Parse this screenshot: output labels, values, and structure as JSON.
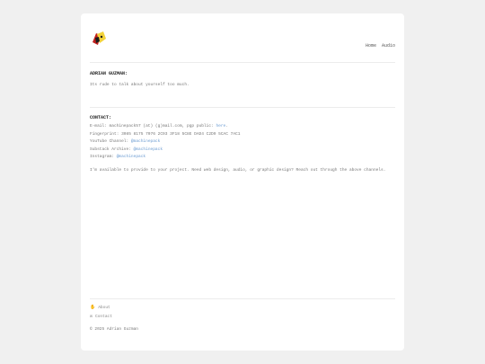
{
  "nav": {
    "home": "Home",
    "audio": "Audio"
  },
  "about": {
    "heading": "ADRIAN GUZMAN:",
    "text": "Its rude to talk about yourself too much."
  },
  "contact": {
    "heading": "CONTACT:",
    "email_label": "E-mail: machinepack57 (at) (g)mail.com, pgp public:",
    "email_link": "here",
    "fingerprint": "Fingerprint: 3085 8175 7076 2C93 3F18 5C8E DAD4 C2D9 5CAC 7AC1",
    "youtube_label": "YouTube Channel:",
    "youtube_link": "@machinepack",
    "substack_label": "Substack Archive:",
    "substack_link": "@machinepack",
    "instagram_label": "Instagram:",
    "instagram_link": "@machinepack",
    "availability": "I'm available to provide to your project. Need web design, audio, or graphic design? Reach out through the above channels."
  },
  "footer": {
    "about_label": "About",
    "contact_label": "Contact",
    "copyright": "© 2025 Adrian Guzman"
  },
  "icons": {
    "about": "hand-icon",
    "contact": "mail-icon"
  },
  "colors": {
    "link": "#6a9bd1",
    "logo_red": "#c0201e",
    "logo_yellow": "#f2d23a"
  }
}
